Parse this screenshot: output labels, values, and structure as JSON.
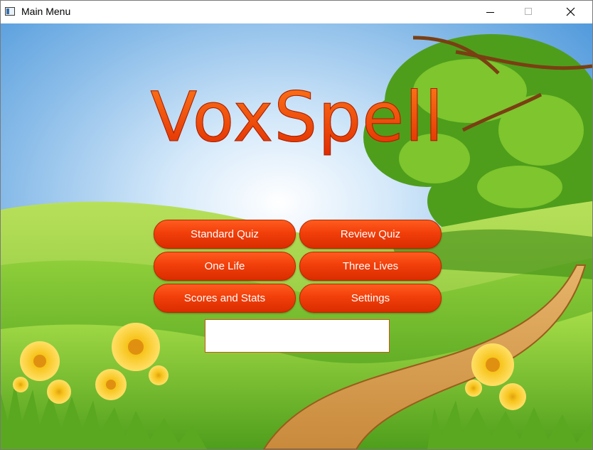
{
  "window": {
    "title": "Main Menu"
  },
  "logo": "VoxSpell",
  "menu": {
    "standard_quiz": "Standard Quiz",
    "review_quiz": "Review Quiz",
    "one_life": "One Life",
    "three_lives": "Three Lives",
    "scores_stats": "Scores and Stats",
    "settings": "Settings"
  },
  "text_field": {
    "value": ""
  },
  "icons": [
    "app-icon",
    "minimize-icon",
    "maximize-icon",
    "close-icon"
  ],
  "colors": {
    "button": "#f23f0a",
    "logo": "#f04a10",
    "sky": "#6fa8e6",
    "grass": "#7cc42c"
  }
}
